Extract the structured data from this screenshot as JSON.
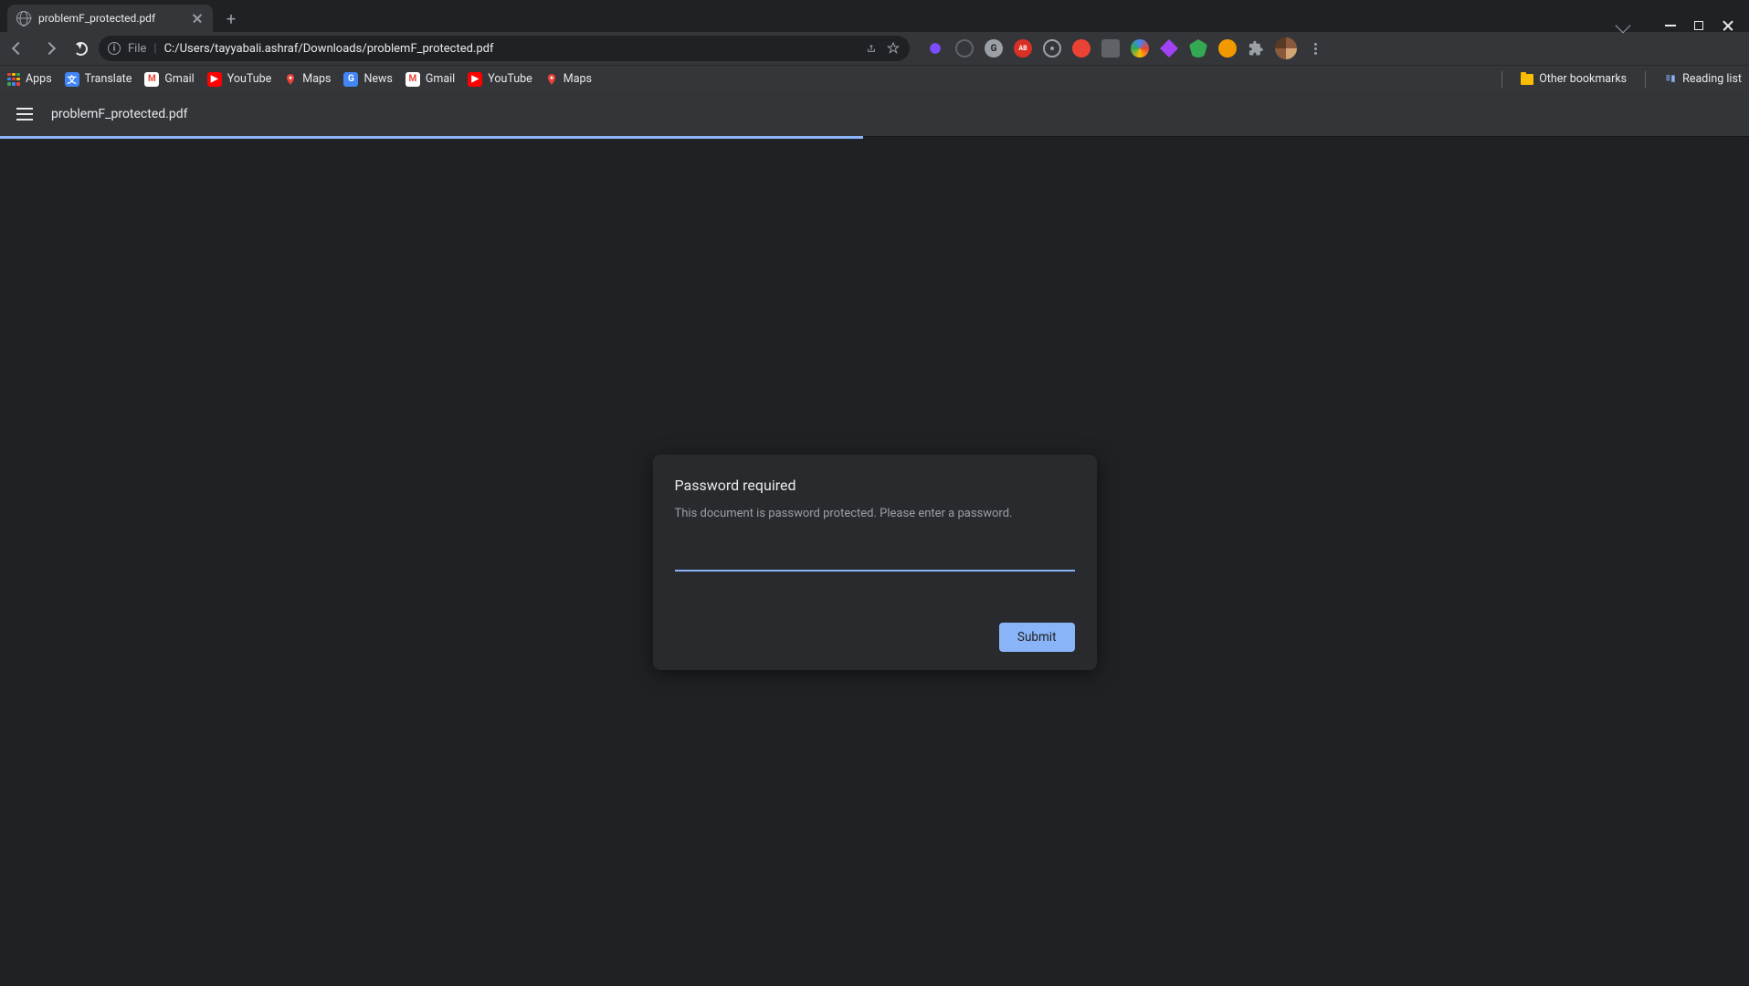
{
  "tab": {
    "title": "problemF_protected.pdf"
  },
  "address": {
    "scheme": "File",
    "separator": "|",
    "path": "C:/Users/tayyabali.ashraf/Downloads/problemF_protected.pdf"
  },
  "bookmarks": {
    "apps": "Apps",
    "items": [
      {
        "label": "Translate",
        "icon": "translate"
      },
      {
        "label": "Gmail",
        "icon": "gmail"
      },
      {
        "label": "YouTube",
        "icon": "youtube"
      },
      {
        "label": "Maps",
        "icon": "maps"
      },
      {
        "label": "News",
        "icon": "news"
      },
      {
        "label": "Gmail",
        "icon": "gmail"
      },
      {
        "label": "YouTube",
        "icon": "youtube"
      },
      {
        "label": "Maps",
        "icon": "maps"
      }
    ],
    "other": "Other bookmarks",
    "reading": "Reading list"
  },
  "pdfbar": {
    "filename": "problemF_protected.pdf"
  },
  "dialog": {
    "title": "Password required",
    "message": "This document is password protected. Please enter a password.",
    "input_value": "",
    "submit": "Submit"
  }
}
